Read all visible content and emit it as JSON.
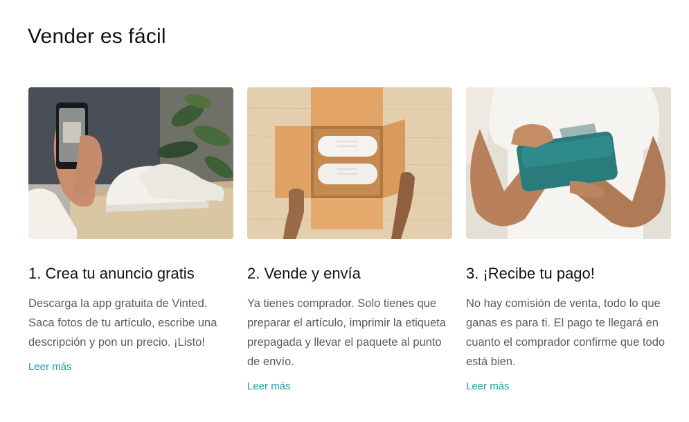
{
  "section": {
    "title": "Vender es fácil"
  },
  "cards": [
    {
      "title": "1. Crea tu anuncio gratis",
      "text": "Descarga la app gratuita de Vinted. Saca fotos de tu artículo, escribe una descripción y pon un precio. ¡Listo!",
      "link": "Leer más"
    },
    {
      "title": "2. Vende y envía",
      "text": "Ya tienes comprador. Solo tienes que preparar el artículo, imprimir la etiqueta prepagada y llevar el paquete al punto de envío.",
      "link": "Leer más"
    },
    {
      "title": "3. ¡Recibe tu pago!",
      "text": "No hay comisión de venta, todo lo que ganas es para ti. El pago te llegará en cuanto el comprador confirme que todo está bien.",
      "link": "Leer más"
    }
  ],
  "colors": {
    "link": "#1b9aa6",
    "body_text": "#5b5b5b",
    "heading": "#111111"
  }
}
